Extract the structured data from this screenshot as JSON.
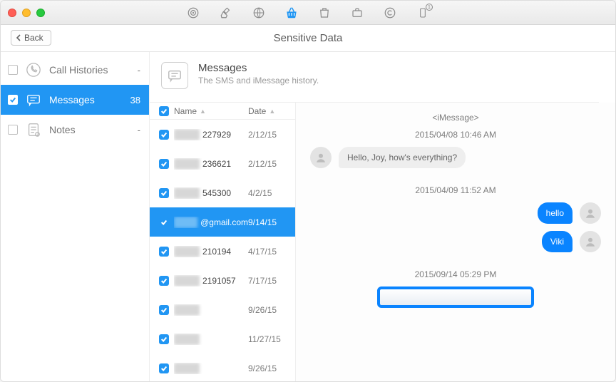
{
  "window": {
    "subtitle": "Sensitive Data",
    "back_label": "Back"
  },
  "sidebar": {
    "items": [
      {
        "label": "Call Histories",
        "count": "-",
        "checked": false,
        "active": false,
        "icon": "phone"
      },
      {
        "label": "Messages",
        "count": "38",
        "checked": true,
        "active": true,
        "icon": "chat"
      },
      {
        "label": "Notes",
        "count": "-",
        "checked": false,
        "active": false,
        "icon": "note"
      }
    ]
  },
  "category": {
    "title": "Messages",
    "description": "The SMS and iMessage history."
  },
  "table": {
    "columns": {
      "name": "Name",
      "date": "Date"
    },
    "rows": [
      {
        "name_vis": "227929",
        "date": "2/12/15",
        "selected": false
      },
      {
        "name_vis": "236621",
        "date": "2/12/15",
        "selected": false
      },
      {
        "name_vis": "545300",
        "date": "4/2/15",
        "selected": false
      },
      {
        "name_vis": "@gmail.com",
        "date": "9/14/15",
        "selected": true
      },
      {
        "name_vis": "210194",
        "date": "4/17/15",
        "selected": false
      },
      {
        "name_vis": "2191057",
        "date": "7/17/15",
        "selected": false
      },
      {
        "name_vis": "",
        "date": "9/26/15",
        "selected": false
      },
      {
        "name_vis": "",
        "date": "11/27/15",
        "selected": false
      },
      {
        "name_vis": "",
        "date": "9/26/15",
        "selected": false
      }
    ]
  },
  "preview": {
    "channel": "<iMessage>",
    "timestamps": [
      "2015/04/08 10:46 AM",
      "2015/04/09 11:52 AM",
      "2015/09/14 05:29 PM"
    ],
    "messages": {
      "incoming1": "Hello, Joy, how's everything?",
      "outgoing1": "hello",
      "outgoing2": "Viki"
    }
  }
}
